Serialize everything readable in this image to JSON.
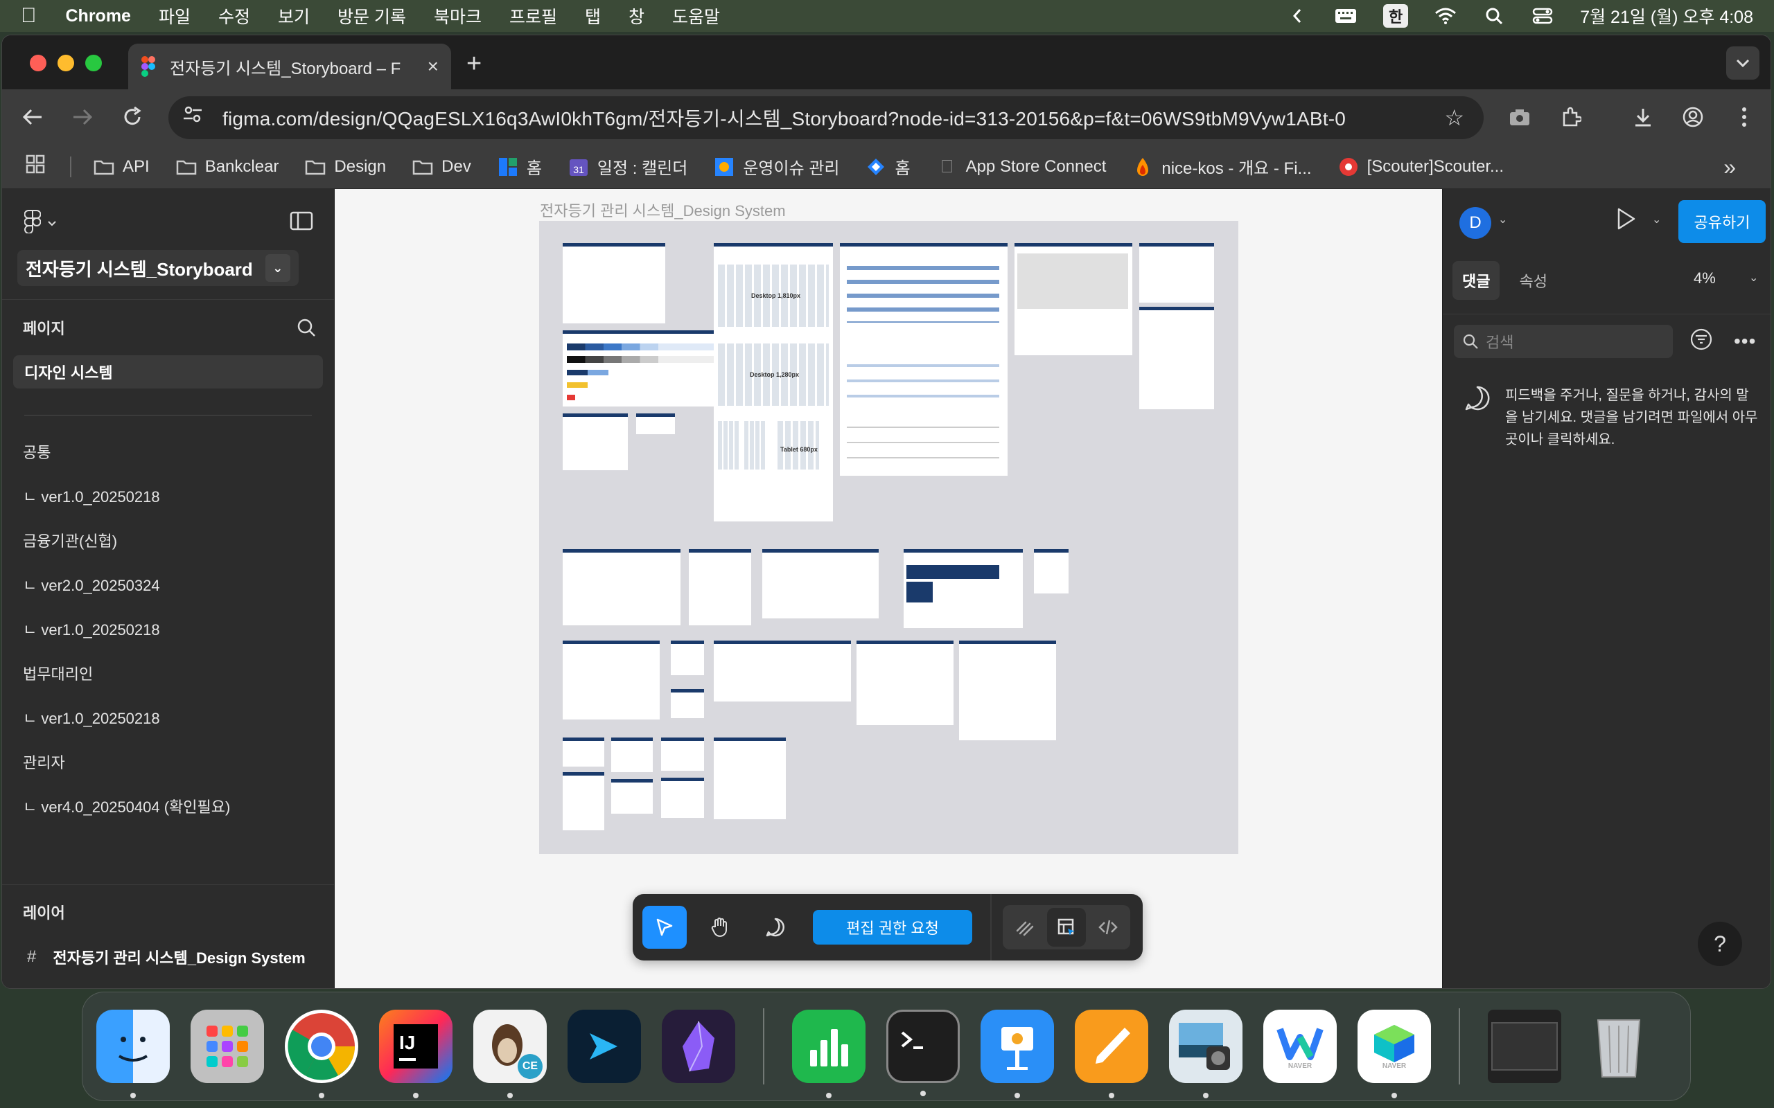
{
  "menubar": {
    "app_name": "Chrome",
    "menus": [
      "파일",
      "수정",
      "보기",
      "방문 기록",
      "북마크",
      "프로필",
      "탭",
      "창",
      "도움말"
    ],
    "ime": "한",
    "datetime": "7월 21일 (월) 오후 4:08"
  },
  "browser": {
    "tab_title": "전자등기 시스템_Storyboard – F",
    "url": "figma.com/design/QQagESLX16q3AwI0khT6gm/전자등기-시스템_Storyboard?node-id=313-20156&p=f&t=06WS9tbM9Vyw1ABt-0",
    "bookmarks": [
      {
        "label": "API",
        "icon": "folder-icon"
      },
      {
        "label": "Bankclear",
        "icon": "folder-icon"
      },
      {
        "label": "Design",
        "icon": "folder-icon"
      },
      {
        "label": "Dev",
        "icon": "folder-icon"
      },
      {
        "label": "홈",
        "icon": "confluence-icon"
      },
      {
        "label": "일정 : 캘린더",
        "icon": "calendar-icon"
      },
      {
        "label": "운영이슈 관리",
        "icon": "jira-icon"
      },
      {
        "label": "홈",
        "icon": "jira-software-icon"
      },
      {
        "label": "App Store Connect",
        "icon": "apple-icon"
      },
      {
        "label": "nice-kos - 개요 - Fi...",
        "icon": "firebase-icon"
      },
      {
        "label": "[Scouter]Scouter...",
        "icon": "scouter-icon"
      }
    ]
  },
  "figma": {
    "file_title": "전자등기 시스템_Storyboard",
    "pages_heading": "페이지",
    "pages": [
      {
        "label": "디자인 시스템",
        "active": true
      },
      {
        "label": "공통"
      },
      {
        "label": "ㄴ ver1.0_20250218"
      },
      {
        "label": "금융기관(신협)"
      },
      {
        "label": "ㄴ ver2.0_20250324"
      },
      {
        "label": "ㄴ ver1.0_20250218"
      },
      {
        "label": "법무대리인"
      },
      {
        "label": "ㄴ ver1.0_20250218"
      },
      {
        "label": "관리자"
      },
      {
        "label": "ㄴ ver4.0_20250404 (확인필요)"
      }
    ],
    "layers_heading": "레이어",
    "layer_item": "전자등기 관리 시스템_Design System",
    "canvas": {
      "frame_label": "전자등기 관리 시스템_Design System",
      "board_labels": {
        "desktop_1810": "Desktop 1,810px",
        "desktop_1280": "Desktop 1,280px",
        "tablet": "Tablet 680px"
      }
    },
    "toolbar": {
      "request_edit": "편집 권한 요청"
    },
    "right_panel": {
      "avatar_letter": "D",
      "share": "공유하기",
      "tabs": [
        "댓글",
        "속성"
      ],
      "zoom": "4%",
      "search_placeholder": "검색",
      "hint": "피드백을 주거나, 질문을 하거나, 감사의 말을 남기세요. 댓글을 남기려면 파일에서 아무 곳이나 클릭하세요.",
      "help": "?"
    }
  },
  "dock": {
    "apps": [
      "Finder",
      "Launchpad",
      "Chrome",
      "IntelliJ IDEA",
      "Sequel Ace",
      "Xcode Cloud",
      "Obsidian",
      "Numbers",
      "Terminal",
      "Keynote",
      "Pages",
      "Preview",
      "Whale",
      "Naver"
    ],
    "naver_label": "NAVER",
    "ij_label": "IJ",
    "ce_label": "CE"
  }
}
